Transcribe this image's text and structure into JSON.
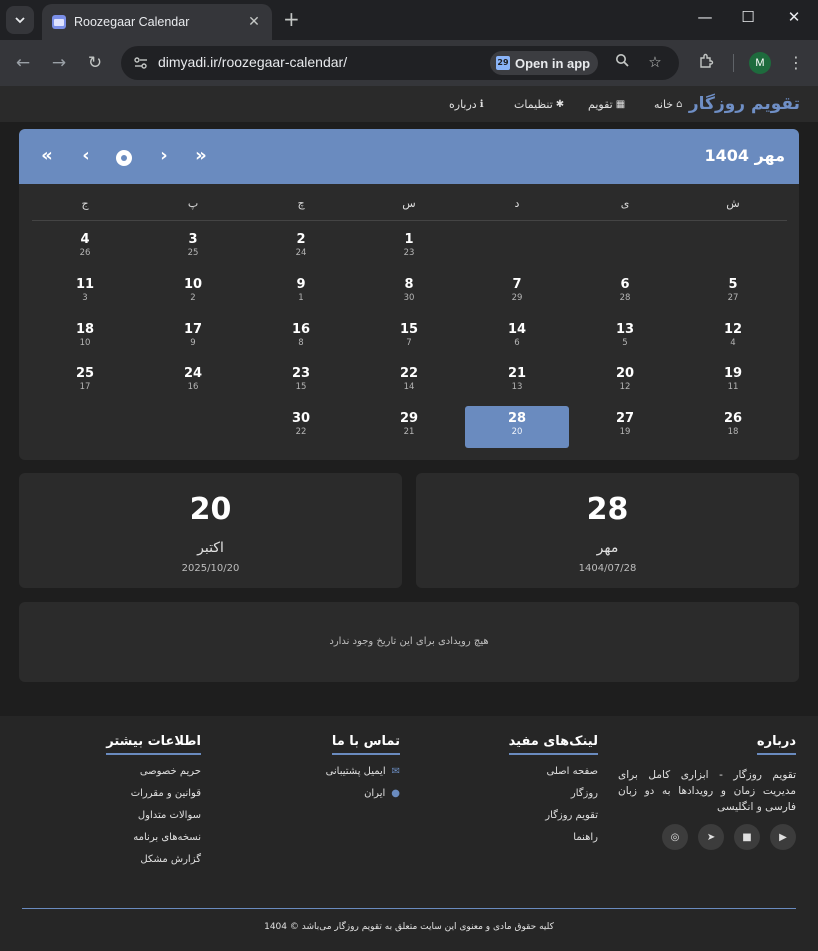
{
  "browser": {
    "tab_title": "Roozegaar Calendar",
    "tab_close": "✕",
    "new_tab": "+",
    "url": "dimyadi.ir/roozegaar-calendar/",
    "open_in_app": "Open in app",
    "profile_initial": "M",
    "window_minimize": "—",
    "window_maximize": "☐",
    "window_close": "✕"
  },
  "navbar": {
    "brand": "تقویم روزگار",
    "items": [
      {
        "label": "خانه",
        "icon": "home-icon"
      },
      {
        "label": "تقویم",
        "icon": "calendar-icon"
      },
      {
        "label": "تنظیمات",
        "icon": "gear-icon"
      },
      {
        "label": "درباره",
        "icon": "info-icon"
      }
    ]
  },
  "calendar": {
    "title": "مهر 1404",
    "weekdays": [
      "ش",
      "ی",
      "د",
      "س",
      "چ",
      "پ",
      "ج"
    ],
    "days": [
      {
        "p": "1",
        "g": "23",
        "col": 3,
        "row": 0
      },
      {
        "p": "2",
        "g": "24",
        "col": 4,
        "row": 0
      },
      {
        "p": "3",
        "g": "25",
        "col": 5,
        "row": 0
      },
      {
        "p": "4",
        "g": "26",
        "col": 6,
        "row": 0
      },
      {
        "p": "5",
        "g": "27",
        "col": 0,
        "row": 1
      },
      {
        "p": "6",
        "g": "28",
        "col": 1,
        "row": 1
      },
      {
        "p": "7",
        "g": "29",
        "col": 2,
        "row": 1
      },
      {
        "p": "8",
        "g": "30",
        "col": 3,
        "row": 1
      },
      {
        "p": "9",
        "g": "1",
        "col": 4,
        "row": 1
      },
      {
        "p": "10",
        "g": "2",
        "col": 5,
        "row": 1
      },
      {
        "p": "11",
        "g": "3",
        "col": 6,
        "row": 1
      },
      {
        "p": "12",
        "g": "4",
        "col": 0,
        "row": 2
      },
      {
        "p": "13",
        "g": "5",
        "col": 1,
        "row": 2
      },
      {
        "p": "14",
        "g": "6",
        "col": 2,
        "row": 2
      },
      {
        "p": "15",
        "g": "7",
        "col": 3,
        "row": 2
      },
      {
        "p": "16",
        "g": "8",
        "col": 4,
        "row": 2
      },
      {
        "p": "17",
        "g": "9",
        "col": 5,
        "row": 2
      },
      {
        "p": "18",
        "g": "10",
        "col": 6,
        "row": 2
      },
      {
        "p": "19",
        "g": "11",
        "col": 0,
        "row": 3
      },
      {
        "p": "20",
        "g": "12",
        "col": 1,
        "row": 3
      },
      {
        "p": "21",
        "g": "13",
        "col": 2,
        "row": 3
      },
      {
        "p": "22",
        "g": "14",
        "col": 3,
        "row": 3
      },
      {
        "p": "23",
        "g": "15",
        "col": 4,
        "row": 3
      },
      {
        "p": "24",
        "g": "16",
        "col": 5,
        "row": 3
      },
      {
        "p": "25",
        "g": "17",
        "col": 6,
        "row": 3
      },
      {
        "p": "26",
        "g": "18",
        "col": 0,
        "row": 4
      },
      {
        "p": "27",
        "g": "19",
        "col": 1,
        "row": 4
      },
      {
        "p": "28",
        "g": "20",
        "col": 2,
        "row": 4,
        "selected": true
      },
      {
        "p": "29",
        "g": "21",
        "col": 3,
        "row": 4
      },
      {
        "p": "30",
        "g": "22",
        "col": 4,
        "row": 4
      }
    ]
  },
  "persian_date": {
    "day": "28",
    "month": "مهر",
    "full": "1404/07/28"
  },
  "gregorian_date": {
    "day": "20",
    "month": "اکتبر",
    "full": "2025/10/20"
  },
  "events": {
    "empty_text": "هیچ رویدادی برای این تاریخ وجود ندارد"
  },
  "footer": {
    "about": {
      "heading": "درباره",
      "text": "تقویم روزگار - ابزاری کامل برای مدیریت زمان و رویدادها به دو زبان فارسی و انگلیسی"
    },
    "links": {
      "heading": "لینک‌های مفید",
      "items": [
        "صفحه اصلی",
        "روزگار",
        "تقویم روزگار",
        "راهنما"
      ]
    },
    "contact": {
      "heading": "تماس با ما",
      "items": [
        {
          "label": "ایمیل پشتیبانی",
          "icon": "envelope-icon"
        },
        {
          "label": "ایران",
          "icon": "map-pin-icon"
        }
      ]
    },
    "more": {
      "heading": "اطلاعات بیشتر",
      "items": [
        "حریم خصوصی",
        "قوانین و مقررات",
        "سوالات متداول",
        "نسخه‌های برنامه",
        "گزارش مشکل"
      ]
    },
    "socials": [
      "youtube-icon",
      "video-icon",
      "telegram-icon",
      "instagram-icon"
    ],
    "copyright": "کلیه حقوق مادی و معنوی این سایت متعلق به تقویم روزگار می‌باشد © 1404"
  },
  "colors": {
    "accent": "#6a8bbf",
    "brand": "#6f8fc6",
    "page_bg": "#1e1e1e",
    "card_bg": "#2b2b2b"
  }
}
